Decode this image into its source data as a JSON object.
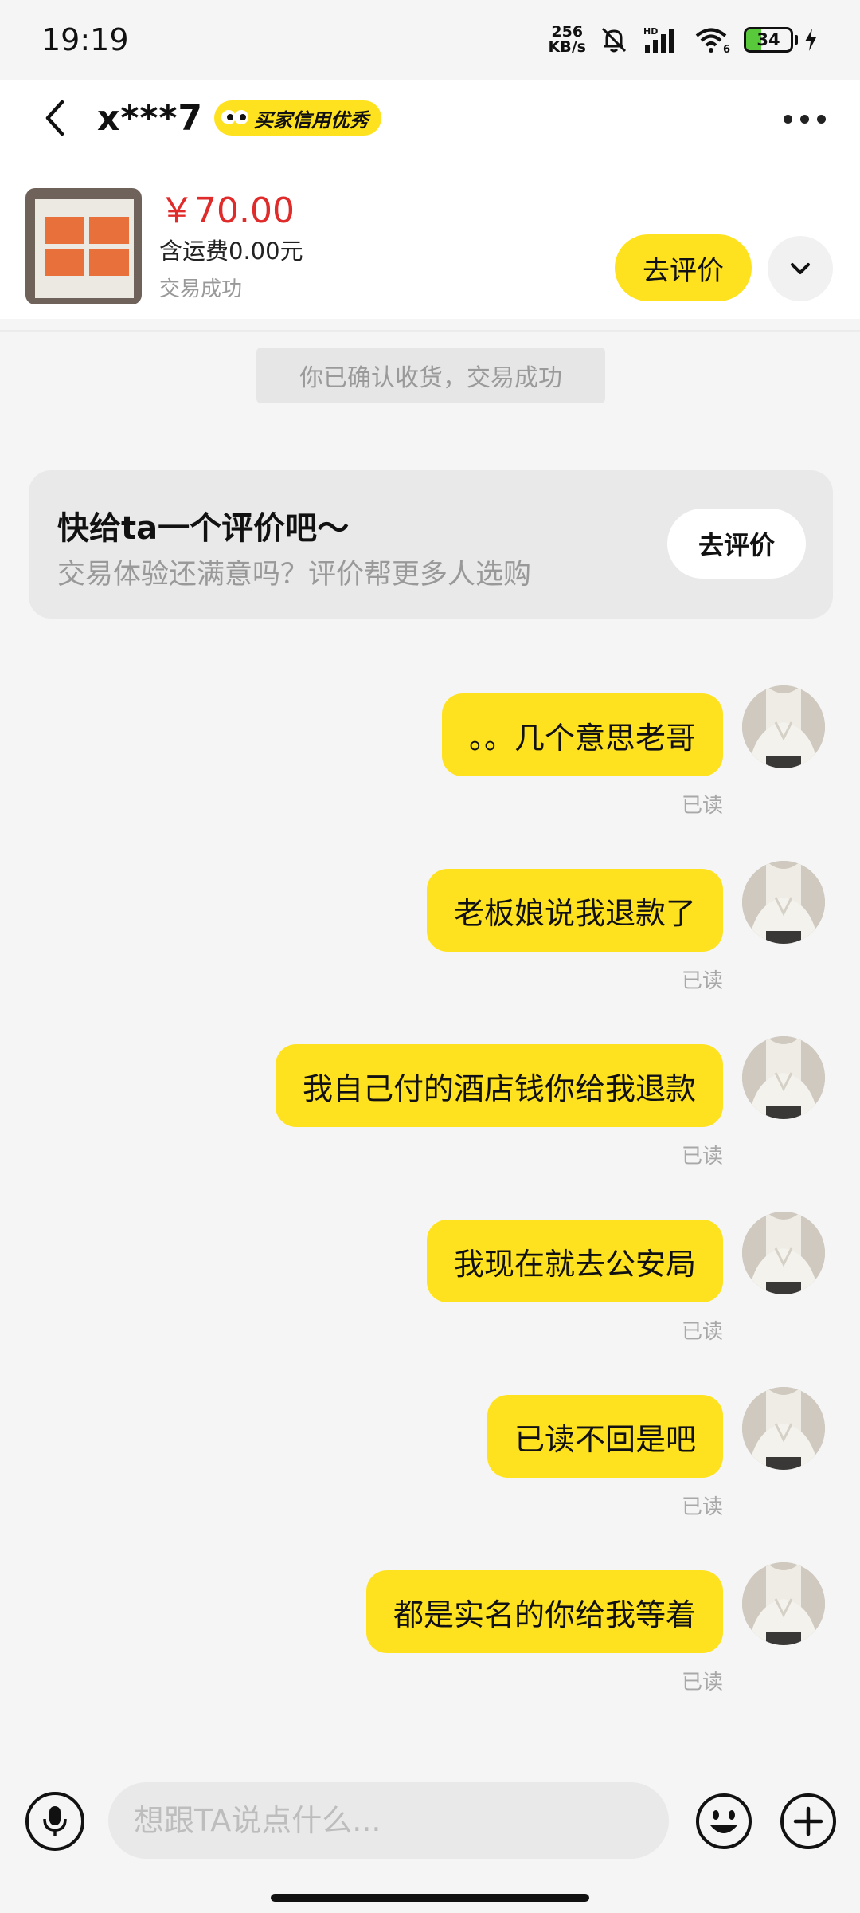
{
  "status_bar": {
    "time": "19:19",
    "net_speed_value": "256",
    "net_speed_unit": "KB/s",
    "signal_label": "HD",
    "wifi_label": "6",
    "battery_level": "34",
    "battery_fraction": 0.34
  },
  "header": {
    "contact_name": "x***7",
    "credit_badge": "买家信用优秀",
    "price": "￥70.00",
    "shipping": "含运费0.00元",
    "trade_status": "交易成功",
    "review_button": "去评价"
  },
  "system_notice": "你已确认收货，交易成功",
  "review_card": {
    "title": "快给ta一个评价吧～",
    "subtitle": "交易体验还满意吗？评价帮更多人选购",
    "button": "去评价"
  },
  "messages": [
    {
      "text": "。。几个意思老哥",
      "status": "已读"
    },
    {
      "text": "老板娘说我退款了",
      "status": "已读"
    },
    {
      "text": "我自己付的酒店钱你给我退款",
      "status": "已读"
    },
    {
      "text": "我现在就去公安局",
      "status": "已读"
    },
    {
      "text": "已读不回是吧",
      "status": "已读"
    },
    {
      "text": "都是实名的你给我等着",
      "status": "已读"
    }
  ],
  "input": {
    "placeholder": "想跟TA说点什么..."
  },
  "colors": {
    "accent_yellow": "#ffe21f",
    "price_red": "#e02b2b",
    "battery_green": "#58c93a"
  },
  "icons": [
    "back-arrow-icon",
    "more-icon",
    "chevron-down-icon",
    "microphone-icon",
    "emoji-icon",
    "plus-icon",
    "mute-bell-icon",
    "signal-icon",
    "wifi-icon",
    "battery-icon",
    "charging-icon"
  ]
}
